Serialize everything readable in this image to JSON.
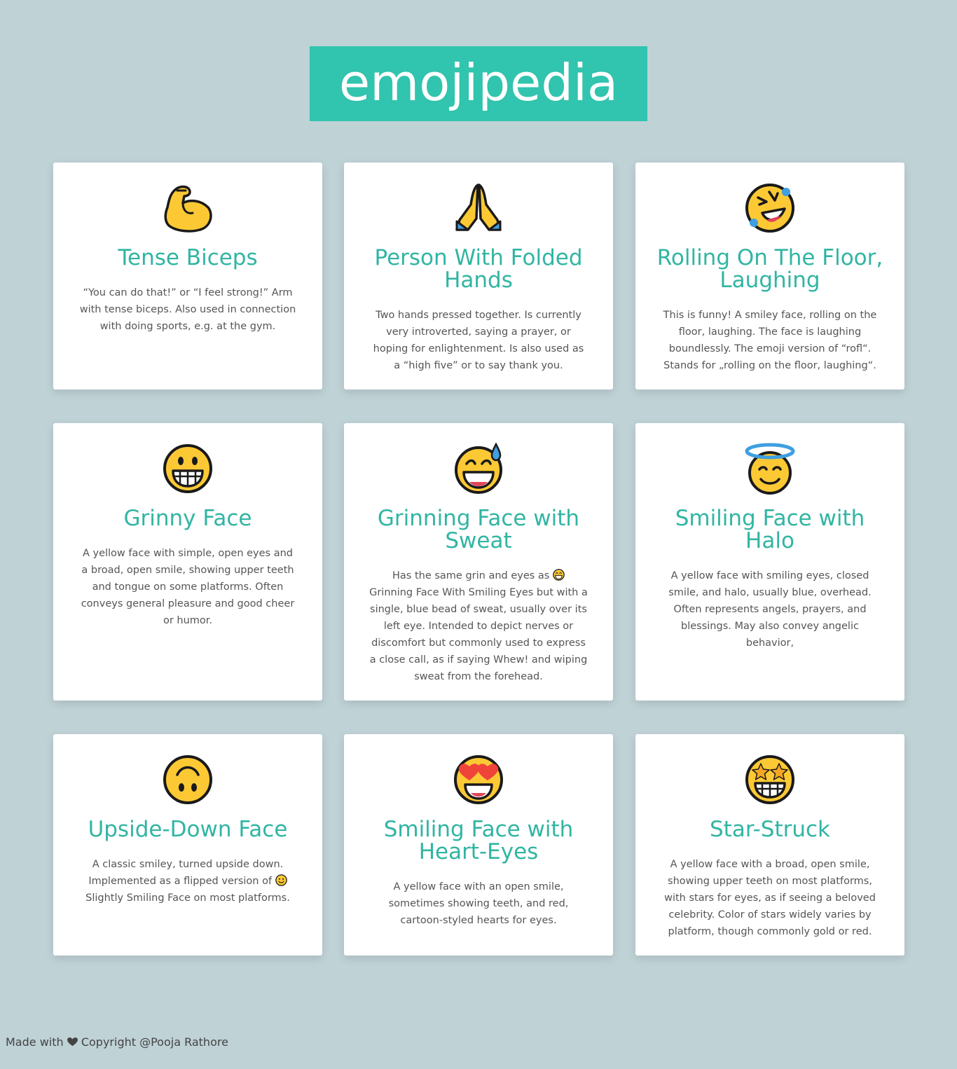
{
  "header": {
    "title": "emojipedia"
  },
  "cards": [
    {
      "icon": "flexed-biceps-icon",
      "title": "Tense Biceps",
      "description": "“You can do that!” or “I feel strong!” Arm with tense biceps. Also used in connection with doing sports, e.g. at the gym."
    },
    {
      "icon": "folded-hands-icon",
      "title": "Person With Folded Hands",
      "description": "Two hands pressed together. Is currently very introverted, saying a prayer, or hoping for enlightenment. Is also used as a “high five” or to say thank you."
    },
    {
      "icon": "rolling-on-the-floor-laughing-icon",
      "title": "Rolling On The Floor, Laughing",
      "description": "This is funny! A smiley face, rolling on the floor, laughing. The face is laughing boundlessly. The emoji version of “rofl“. Stands for „rolling on the floor, laughing“."
    },
    {
      "icon": "grinning-face-icon",
      "title": "Grinny Face",
      "description": "A yellow face with simple, open eyes and a broad, open smile, showing upper teeth and tongue on some platforms. Often conveys general pleasure and good cheer or humor."
    },
    {
      "icon": "grinning-face-with-sweat-icon",
      "title": "Grinning Face with Sweat",
      "description_before": "Has the same grin and eyes as",
      "inline_icon": "grinning-face-with-smiling-eyes-icon",
      "description_after": "Grinning Face With Smiling Eyes but with a single, blue bead of sweat, usually over its left eye. Intended to depict nerves or discomfort but commonly used to express a close call, as if saying Whew! and wiping sweat from the forehead."
    },
    {
      "icon": "smiling-face-with-halo-icon",
      "title": "Smiling Face with Halo",
      "description": "A yellow face with smiling eyes, closed smile, and halo, usually blue, overhead. Often represents angels, prayers, and blessings. May also convey angelic behavior,"
    },
    {
      "icon": "upside-down-face-icon",
      "title": "Upside-Down Face",
      "description_before": "A classic smiley, turned upside down. Implemented as a flipped version of",
      "inline_icon": "slightly-smiling-face-icon",
      "description_after": "Slightly Smiling Face on most platforms."
    },
    {
      "icon": "heart-eyes-icon",
      "title": "Smiling Face with Heart-Eyes",
      "description": "A yellow face with an open smile, sometimes showing teeth, and red, cartoon-styled hearts for eyes."
    },
    {
      "icon": "star-struck-icon",
      "title": "Star-Struck",
      "description": "A yellow face with a broad, open smile, showing upper teeth on most platforms, with stars for eyes, as if seeing a beloved celebrity. Color of stars widely varies by platform, though commonly gold or red."
    }
  ],
  "footer": {
    "made_with": "Made with",
    "heart_icon": "heart-icon",
    "copyright": "Copyright @Pooja Rathore"
  },
  "colors": {
    "background": "#bfd2d6",
    "accent": "#31c4ae",
    "title": "#31b5a3",
    "emoji_yellow": "#fcc934",
    "emoji_blue": "#3f9fe0"
  }
}
